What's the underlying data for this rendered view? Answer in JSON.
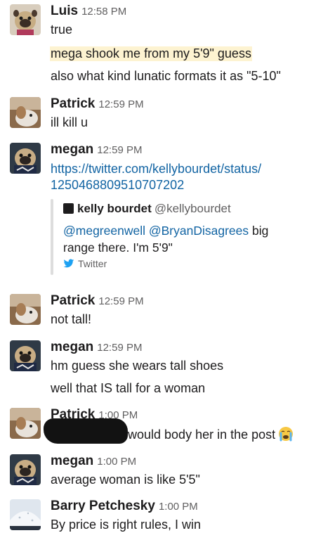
{
  "messages": [
    {
      "author": "Luis",
      "time": "12:58 PM",
      "avatar": "pug-avatar",
      "lines": [
        "true",
        "mega shook me from my 5'9\" guess",
        "also what kind lunatic formats it as \"5-10\""
      ]
    },
    {
      "author": "Patrick",
      "time": "12:59 PM",
      "avatar": "dog-avatar",
      "lines": [
        "ill kill u"
      ]
    },
    {
      "author": "megan",
      "time": "12:59 PM",
      "avatar": "pug-avatar",
      "link_line1": "https://twitter.com/kellybourdet/status/",
      "link_line2": "1250468809510707202",
      "quote": {
        "name": "kelly bourdet",
        "handle": "@kellybourdet",
        "mention1": "@megreenwell",
        "mention2": "@BryanDisagrees",
        "text1_suffix": " big",
        "text2": "range there. I'm 5'9\"",
        "footer": "Twitter"
      }
    },
    {
      "author": "Patrick",
      "time": "12:59 PM",
      "avatar": "dog-avatar",
      "lines": [
        "not tall!"
      ]
    },
    {
      "author": "megan",
      "time": "12:59 PM",
      "avatar": "pug-avatar",
      "lines": [
        "hm guess she wears tall shoes",
        "well that IS tall for a woman"
      ]
    },
    {
      "author": "Patrick",
      "time": "1:00 PM",
      "avatar": "dog-avatar",
      "lines": [
        "would body her in the post"
      ],
      "emoji": "crying-face"
    },
    {
      "author": "megan",
      "time": "1:00 PM",
      "avatar": "pug-avatar",
      "lines": [
        "average woman is like 5'5\""
      ]
    },
    {
      "author": "Barry Petchesky",
      "time": "1:00 PM",
      "avatar": "snow-avatar",
      "lines": [
        "By price is right rules, I win"
      ]
    }
  ],
  "colors": {
    "link": "#1264a3",
    "highlight": "#fdf3d1",
    "timestamp": "#616061"
  }
}
